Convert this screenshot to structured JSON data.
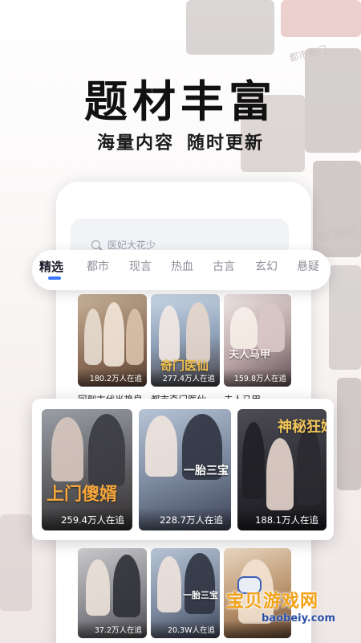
{
  "headline": "题材丰富",
  "subline": [
    "海量内容",
    "随时更新"
  ],
  "search": {
    "placeholder": "医妃大花少"
  },
  "tabs": [
    {
      "label": "精选",
      "active": true
    },
    {
      "label": "都市",
      "active": false
    },
    {
      "label": "现言",
      "active": false
    },
    {
      "label": "热血",
      "active": false
    },
    {
      "label": "古言",
      "active": false
    },
    {
      "label": "玄幻",
      "active": false
    },
    {
      "label": "悬疑",
      "active": false
    }
  ],
  "top_posters": [
    {
      "views": "180.2万人在追",
      "title": "回到古代当艳皇"
    },
    {
      "views": "277.4万人在追",
      "title": "都市奇门医仙",
      "poster_text": "奇门医仙"
    },
    {
      "views": "159.8万人在追",
      "title": "夫人马甲",
      "poster_text": "夫人马甲"
    }
  ],
  "featured_posters": [
    {
      "views": "259.4万人在追",
      "poster_text": "上门傻婿"
    },
    {
      "views": "228.7万人在追",
      "poster_text": "一胎三宝"
    },
    {
      "views": "188.1万人在追",
      "poster_text": "神秘狂婿"
    }
  ],
  "bottom_posters": [
    {
      "views": "37.2万人在追"
    },
    {
      "views": "20.3W人在追",
      "poster_text": "一胎三宝"
    },
    {
      "views": ""
    }
  ],
  "background_labels": [
    "都市奇门",
    "奇门医仙"
  ],
  "watermark": {
    "text": "宝贝游戏网",
    "url": "baobeiy.com"
  },
  "colors": {
    "accent": "#3a78ff",
    "headline": "#111111",
    "gold": "#f4c24e"
  }
}
